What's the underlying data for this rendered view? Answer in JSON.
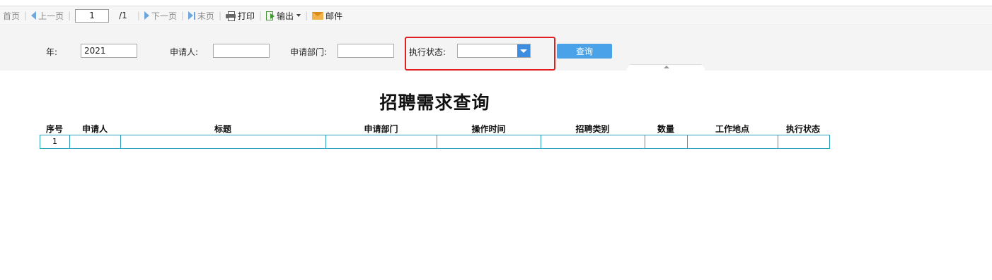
{
  "toolbar": {
    "first": "首页",
    "prev": "上一页",
    "page_value": "1",
    "page_total": "/1",
    "next": "下一页",
    "last": "末页",
    "print": "打印",
    "export": "输出",
    "mail": "邮件"
  },
  "filter": {
    "year_label": "年:",
    "year_value": "2021",
    "applicant_label": "申请人:",
    "applicant_value": "",
    "dept_label": "申请部门:",
    "dept_value": "",
    "status_label": "执行状态:",
    "status_value": "",
    "query_button": "查询"
  },
  "report": {
    "title": "招聘需求查询",
    "columns": [
      "序号",
      "申请人",
      "标题",
      "申请部门",
      "操作时间",
      "招聘类别",
      "数量",
      "工作地点",
      "执行状态"
    ],
    "rows": [
      [
        "1",
        "",
        "",
        "",
        "",
        "",
        "",
        "",
        ""
      ]
    ]
  },
  "colors": {
    "accent": "#4aa3e9",
    "table_border": "#2a9fbf",
    "highlight": "#e02020"
  }
}
